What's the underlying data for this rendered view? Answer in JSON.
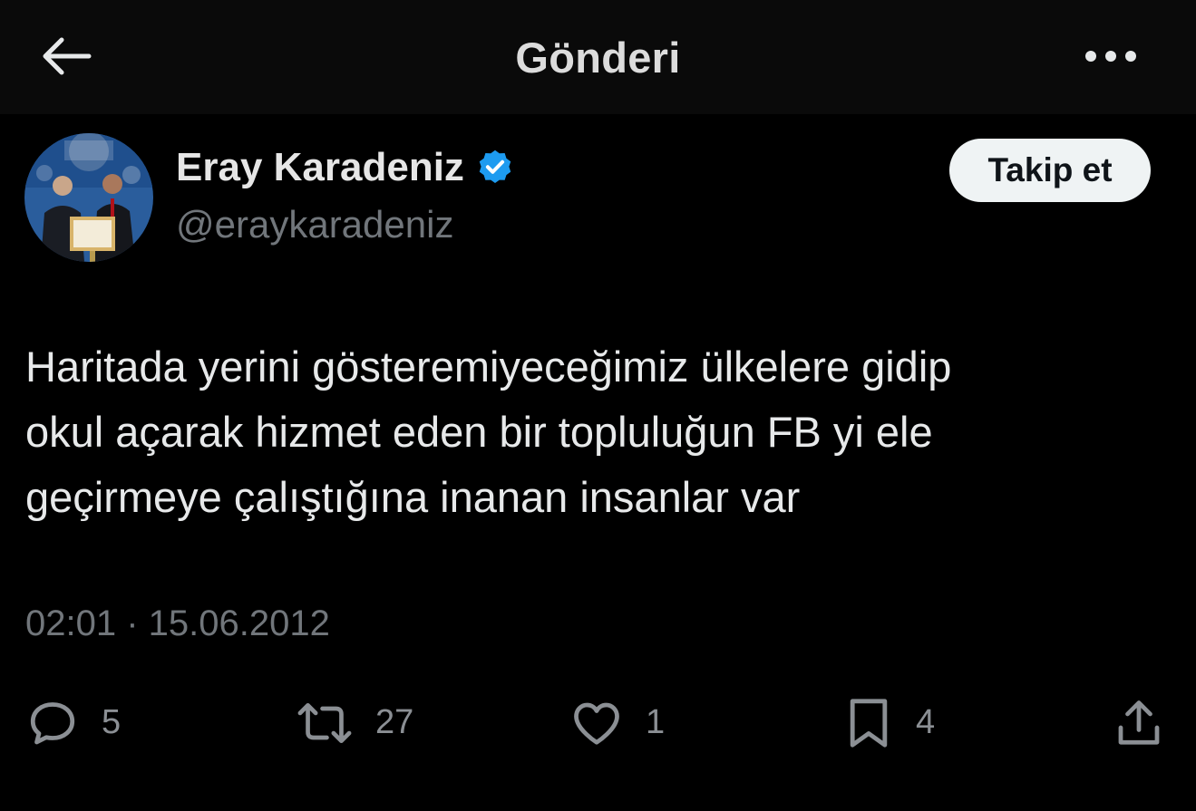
{
  "header": {
    "title": "Gönderi",
    "back_icon": "arrow-left-icon",
    "more_icon": "more-horizontal-icon"
  },
  "author": {
    "display_name": "Eray Karadeniz",
    "handle": "@eraykaradeniz",
    "verified_icon": "verified-badge-icon",
    "verified_color": "#1d9bf0"
  },
  "follow_button": {
    "label": "Takip et"
  },
  "tweet": {
    "lines": [
      "Haritada yerini gösteremiyeceğimiz ülkelere gidip",
      "okul açarak hizmet eden bir topluluğun FB yi ele",
      "geçirmeye çalıştığına inanan insanlar var"
    ],
    "timestamp": "02:01 · 15.06.2012"
  },
  "actions": {
    "reply": {
      "icon": "reply-icon",
      "count": "5"
    },
    "retweet": {
      "icon": "retweet-icon",
      "count": "27"
    },
    "like": {
      "icon": "heart-icon",
      "count": "1"
    },
    "bookmark": {
      "icon": "bookmark-icon",
      "count": "4"
    },
    "share": {
      "icon": "share-icon"
    }
  },
  "colors": {
    "background": "#000000",
    "header_background": "#0a0a0a",
    "text": "#e7e9ea",
    "secondary_text": "#71767b",
    "follow_bg": "#eff3f4"
  }
}
